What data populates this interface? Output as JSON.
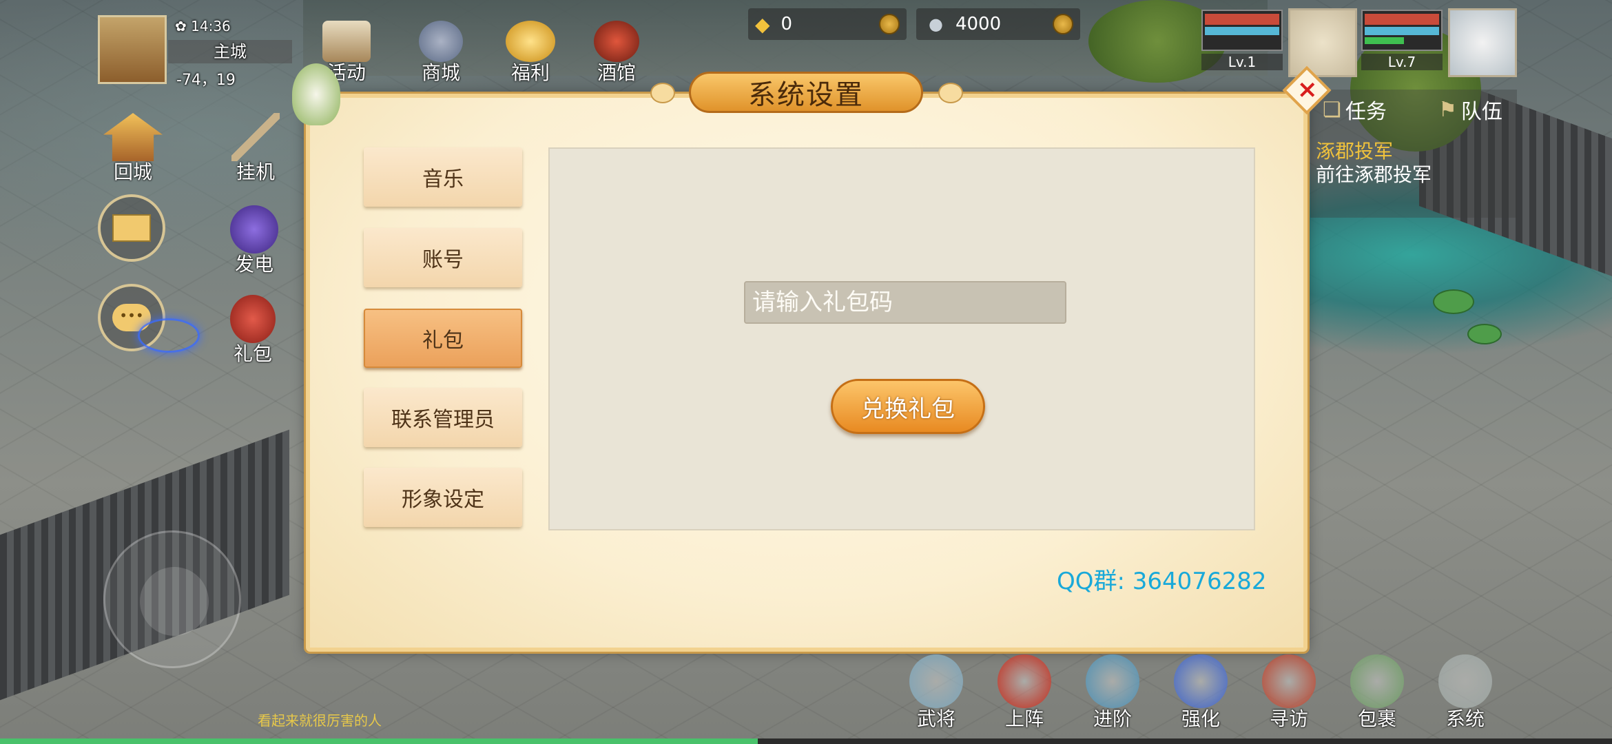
{
  "status": {
    "time": "14:36",
    "location": "主城",
    "coords": "-74，19"
  },
  "currency": {
    "gold": "0",
    "silver": "4000"
  },
  "top_menu": [
    {
      "label": "活动",
      "icon": "scroll-icon"
    },
    {
      "label": "商城",
      "icon": "shop-bag-icon"
    },
    {
      "label": "福利",
      "icon": "coins-icon"
    },
    {
      "label": "酒馆",
      "icon": "tavern-icon"
    }
  ],
  "left_menu": {
    "return_city": "回城",
    "auto_battle": "挂机",
    "power": "发电",
    "gift": "礼包"
  },
  "team": {
    "card1_level": "Lv.1",
    "card2_level": "Lv.7"
  },
  "quest": {
    "tab_task": "任务",
    "tab_team": "队伍",
    "title": "涿郡投军",
    "desc": "前往涿郡投军"
  },
  "modal": {
    "title": "系统设置",
    "close_symbol": "×",
    "tabs": [
      "音乐",
      "账号",
      "礼包",
      "联系管理员",
      "形象设定"
    ],
    "active_tab": "礼包",
    "gift_input_placeholder": "请输入礼包码",
    "redeem_label": "兑换礼包",
    "qq_group": "QQ群: 364076282"
  },
  "bottom_menu": [
    {
      "label": "武将",
      "icon": "helmet-icon",
      "color": "#7aa3b8"
    },
    {
      "label": "上阵",
      "icon": "flame-sword-icon",
      "color": "#c22a1a"
    },
    {
      "label": "进阶",
      "icon": "upgrade-icon",
      "color": "#4c8fb3"
    },
    {
      "label": "强化",
      "icon": "enhance-icon",
      "color": "#3c62c9"
    },
    {
      "label": "寻访",
      "icon": "lantern-icon",
      "color": "#b8402a"
    },
    {
      "label": "包裹",
      "icon": "bag-icon",
      "color": "#6d9a64"
    },
    {
      "label": "系统",
      "icon": "system-gear-icon",
      "color": "#9aa3a0"
    }
  ],
  "caption": "看起来就很厉害的人",
  "exp_fraction": 0.47
}
